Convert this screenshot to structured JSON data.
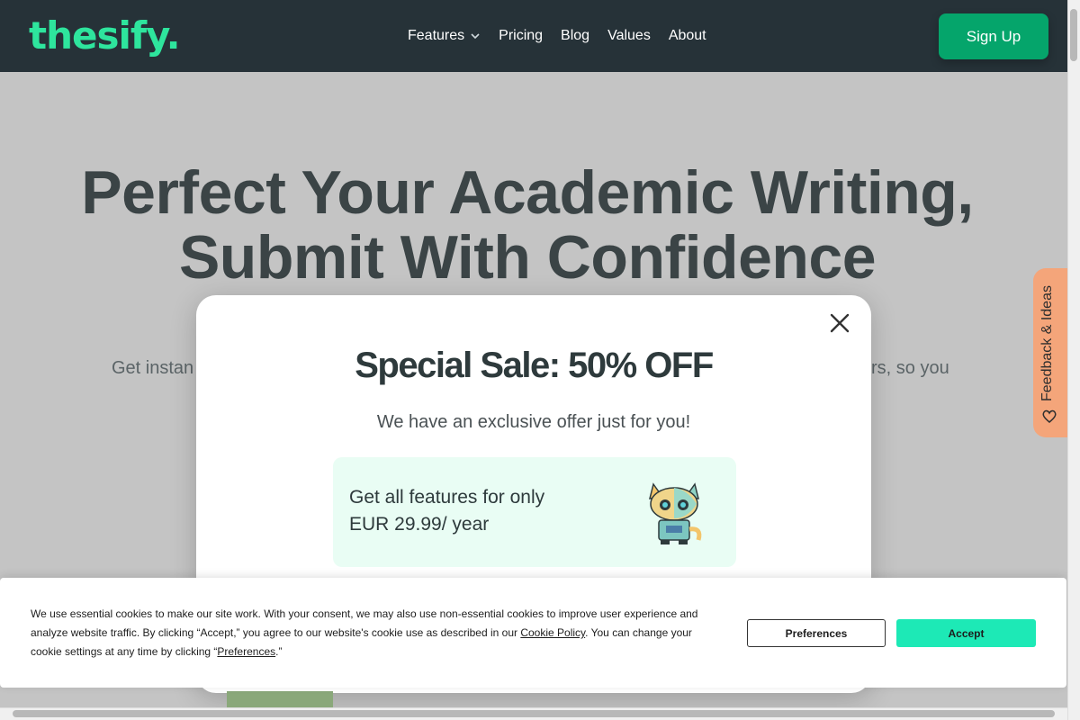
{
  "header": {
    "logo": "thesify.",
    "nav": [
      "Features",
      "Pricing",
      "Blog",
      "Values",
      "About"
    ],
    "signup_label": "Sign Up"
  },
  "hero": {
    "title_line1": "Perfect Your Academic Writing,",
    "title_line2": "Submit With Confidence",
    "subtitle_left": "Get instan",
    "subtitle_right": "rs, so you"
  },
  "feedback_tab": {
    "label": "Feedback & Ideas"
  },
  "modal": {
    "title": "Special Sale: 50% OFF",
    "subtitle": "We have an exclusive offer just for you!",
    "offer_line1": "Get all features for only",
    "offer_line2": "EUR 29.99/ year"
  },
  "cookie": {
    "text_part1": "We use essential cookies to make our site work. With your consent, we may also use non-essential cookies to improve user experience and analyze website traffic. By clicking “Accept,” you agree to our website's cookie use as described in our ",
    "link_policy": "Cookie Policy",
    "text_part2": ". You can change your cookie settings at any time by clicking “",
    "link_prefs": "Preferences",
    "text_part3": ".”",
    "preferences_label": "Preferences",
    "accept_label": "Accept"
  },
  "colors": {
    "header_bg": "#263238",
    "brand_green": "#2ee59d",
    "signup_bg": "#05a56b",
    "accept_bg": "#1de9b6",
    "feedback_bg": "#f4a57a",
    "offer_bg": "#e9fdf4"
  }
}
